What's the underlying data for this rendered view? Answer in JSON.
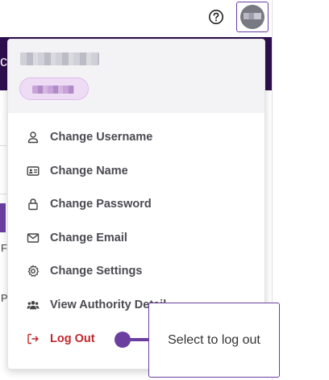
{
  "header": {
    "help_icon": "question-circle-icon",
    "avatar_icon": "user-avatar"
  },
  "page_fragments": {
    "left_letter": "c",
    "row_f": "F",
    "row_p": "P"
  },
  "dropdown": {
    "username_redacted": true,
    "role_badge_redacted": true,
    "items": [
      {
        "label": "Change Username",
        "icon": "user-icon"
      },
      {
        "label": "Change Name",
        "icon": "id-card-icon"
      },
      {
        "label": "Change Password",
        "icon": "lock-icon"
      },
      {
        "label": "Change Email",
        "icon": "mail-icon"
      },
      {
        "label": "Change Settings",
        "icon": "gear-icon"
      },
      {
        "label": "View Authority Detail",
        "icon": "users-icon"
      },
      {
        "label": "Log Out",
        "icon": "logout-icon",
        "color": "#c0272d"
      }
    ]
  },
  "callout": {
    "text": "Select to log out",
    "color": "#6b3fa0"
  }
}
